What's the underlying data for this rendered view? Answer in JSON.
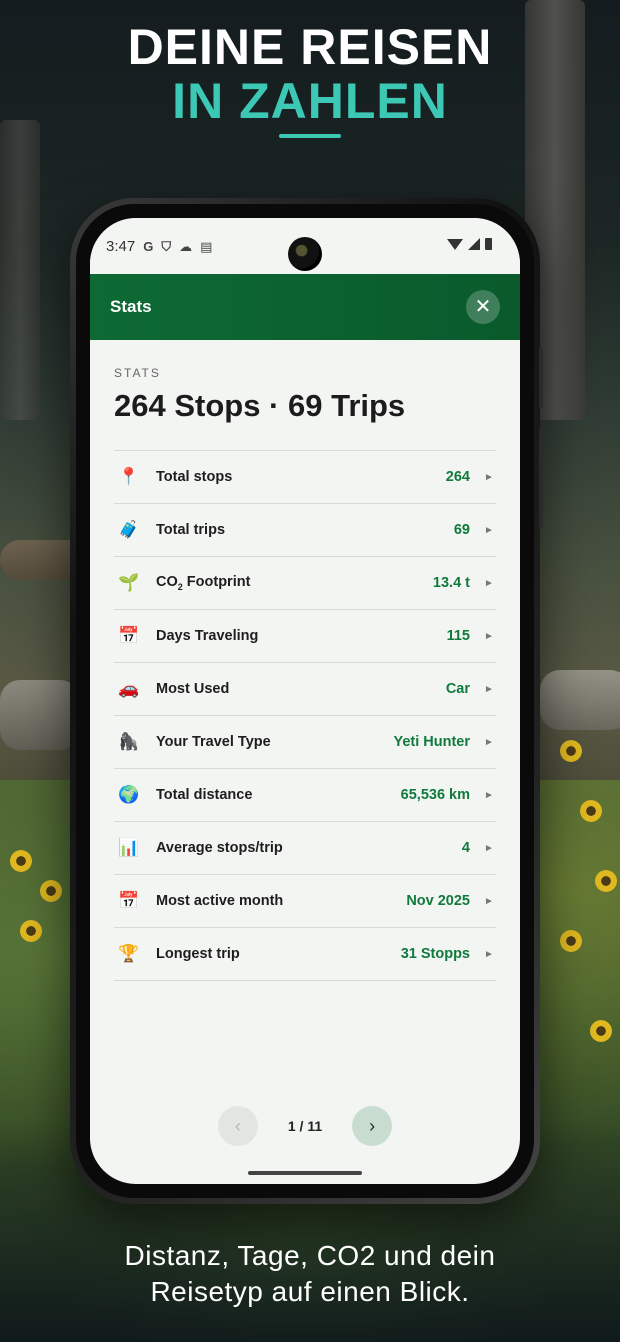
{
  "promo": {
    "headline_line1": "DEINE REISEN",
    "headline_line2": "IN ZAHLEN",
    "caption_line1": "Distanz, Tage, CO2 und dein",
    "caption_line2": "Reisetyp auf einen Blick."
  },
  "statusbar": {
    "time": "3:47",
    "icons": [
      "google-icon",
      "shield-icon",
      "cloud-icon",
      "calendar-icon"
    ],
    "right_icons": [
      "wifi-icon",
      "signal-icon",
      "battery-icon"
    ]
  },
  "appbar": {
    "title": "Stats",
    "close_icon": "close-icon"
  },
  "stats": {
    "overline": "STATS",
    "summary": "264 Stops · 69 Trips",
    "rows": [
      {
        "icon": "📍",
        "icon_name": "pin-icon",
        "label": "Total stops",
        "value": "264"
      },
      {
        "icon": "🧳",
        "icon_name": "luggage-icon",
        "label": "Total trips",
        "value": "69"
      },
      {
        "icon": "🌱",
        "icon_name": "seedling-icon",
        "label_main": "CO",
        "label_sub": "2",
        "label_rest": " Footprint",
        "value": "13.4 t"
      },
      {
        "icon": "📅",
        "icon_name": "calendar-icon",
        "label": "Days Traveling",
        "value": "115"
      },
      {
        "icon": "🚗",
        "icon_name": "car-icon",
        "label": "Most Used",
        "value": "Car"
      },
      {
        "icon": "🦍",
        "icon_name": "yeti-icon",
        "label": "Your Travel Type",
        "value": "Yeti Hunter"
      },
      {
        "icon": "🌍",
        "icon_name": "globe-icon",
        "label": "Total distance",
        "value": "65,536 km"
      },
      {
        "icon": "📊",
        "icon_name": "bar-chart-icon",
        "label": "Average stops/trip",
        "value": "4"
      },
      {
        "icon": "📅",
        "icon_name": "calendar-icon",
        "label": "Most active month",
        "value": "Nov 2025"
      },
      {
        "icon": "🏆",
        "icon_name": "trophy-icon",
        "label": "Longest trip",
        "value": "31 Stopps"
      }
    ],
    "arrow": "►"
  },
  "pager": {
    "prev": "‹",
    "next": "›",
    "label": "1 / 11"
  },
  "colors": {
    "accent_teal": "#3cc8b4",
    "appbar_green": "#0d6a35",
    "value_green": "#107a3c"
  }
}
